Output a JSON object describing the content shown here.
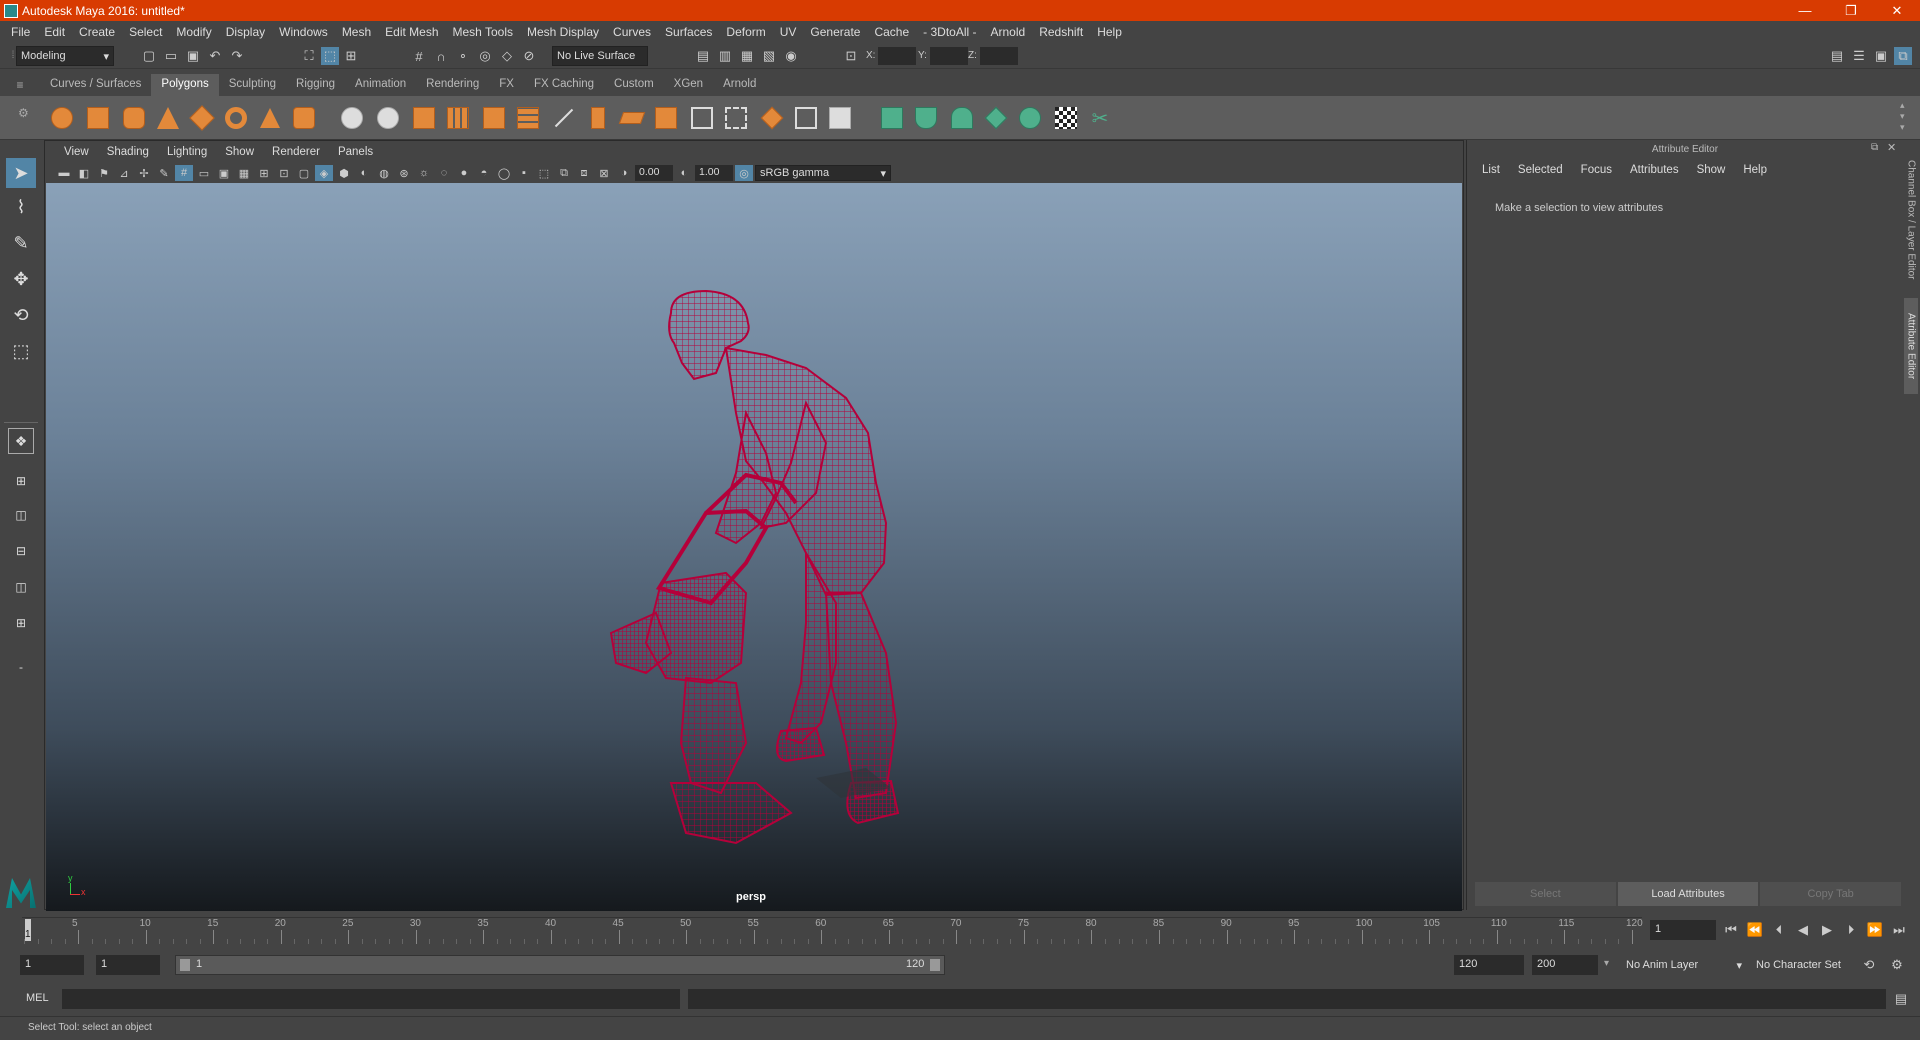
{
  "window": {
    "title": "Autodesk Maya 2016: untitled*",
    "controls": [
      "—",
      "❐",
      "✕"
    ]
  },
  "menubar": [
    "File",
    "Edit",
    "Create",
    "Select",
    "Modify",
    "Display",
    "Windows",
    "Mesh",
    "Edit Mesh",
    "Mesh Tools",
    "Mesh Display",
    "Curves",
    "Surfaces",
    "Deform",
    "UV",
    "Generate",
    "Cache",
    "- 3DtoAll -",
    "Arnold",
    "Redshift",
    "Help"
  ],
  "statusline": {
    "mode": "Modeling",
    "live_surface": "No Live Surface",
    "coord_labels": [
      "X:",
      "Y:",
      "Z:"
    ]
  },
  "shelf_tabs": [
    "Curves / Surfaces",
    "Polygons",
    "Sculpting",
    "Rigging",
    "Animation",
    "Rendering",
    "FX",
    "FX Caching",
    "Custom",
    "XGen",
    "Arnold"
  ],
  "active_shelf": "Polygons",
  "viewport": {
    "menu": [
      "View",
      "Shading",
      "Lighting",
      "Show",
      "Renderer",
      "Panels"
    ],
    "exposure": "0.00",
    "gamma": "1.00",
    "color_space": "sRGB gamma",
    "camera_label": "persp",
    "axis_y": "y",
    "axis_x": "x",
    "wireframe_color": "#b5003a"
  },
  "attribute_editor": {
    "title": "Attribute Editor",
    "menu": [
      "List",
      "Selected",
      "Focus",
      "Attributes",
      "Show",
      "Help"
    ],
    "message": "Make a selection to view attributes",
    "buttons": [
      "Select",
      "Load Attributes",
      "Copy Tab"
    ]
  },
  "side_tabs": [
    "Channel Box / Layer Editor",
    "Attribute Editor"
  ],
  "timeline": {
    "ticks": [
      "5",
      "10",
      "15",
      "20",
      "25",
      "30",
      "35",
      "40",
      "45",
      "50",
      "55",
      "60",
      "65",
      "70",
      "75",
      "80",
      "85",
      "90",
      "95",
      "100",
      "105",
      "110",
      "115",
      "120"
    ],
    "current_frame_marker": "1",
    "current_frame": "1"
  },
  "range": {
    "start": "1",
    "playback_start": "1",
    "slider_start": "1",
    "slider_end": "120",
    "playback_end": "120",
    "end": "200",
    "anim_layer": "No Anim Layer",
    "character_set": "No Character Set"
  },
  "cmdline": {
    "label": "MEL"
  },
  "helpline": {
    "text": "Select Tool: select an object"
  },
  "colors": {
    "titlebar": "#d83b01",
    "accent": "#5285a6",
    "shelf_orange": "#e3893a",
    "shelf_green": "#4fb08c"
  }
}
